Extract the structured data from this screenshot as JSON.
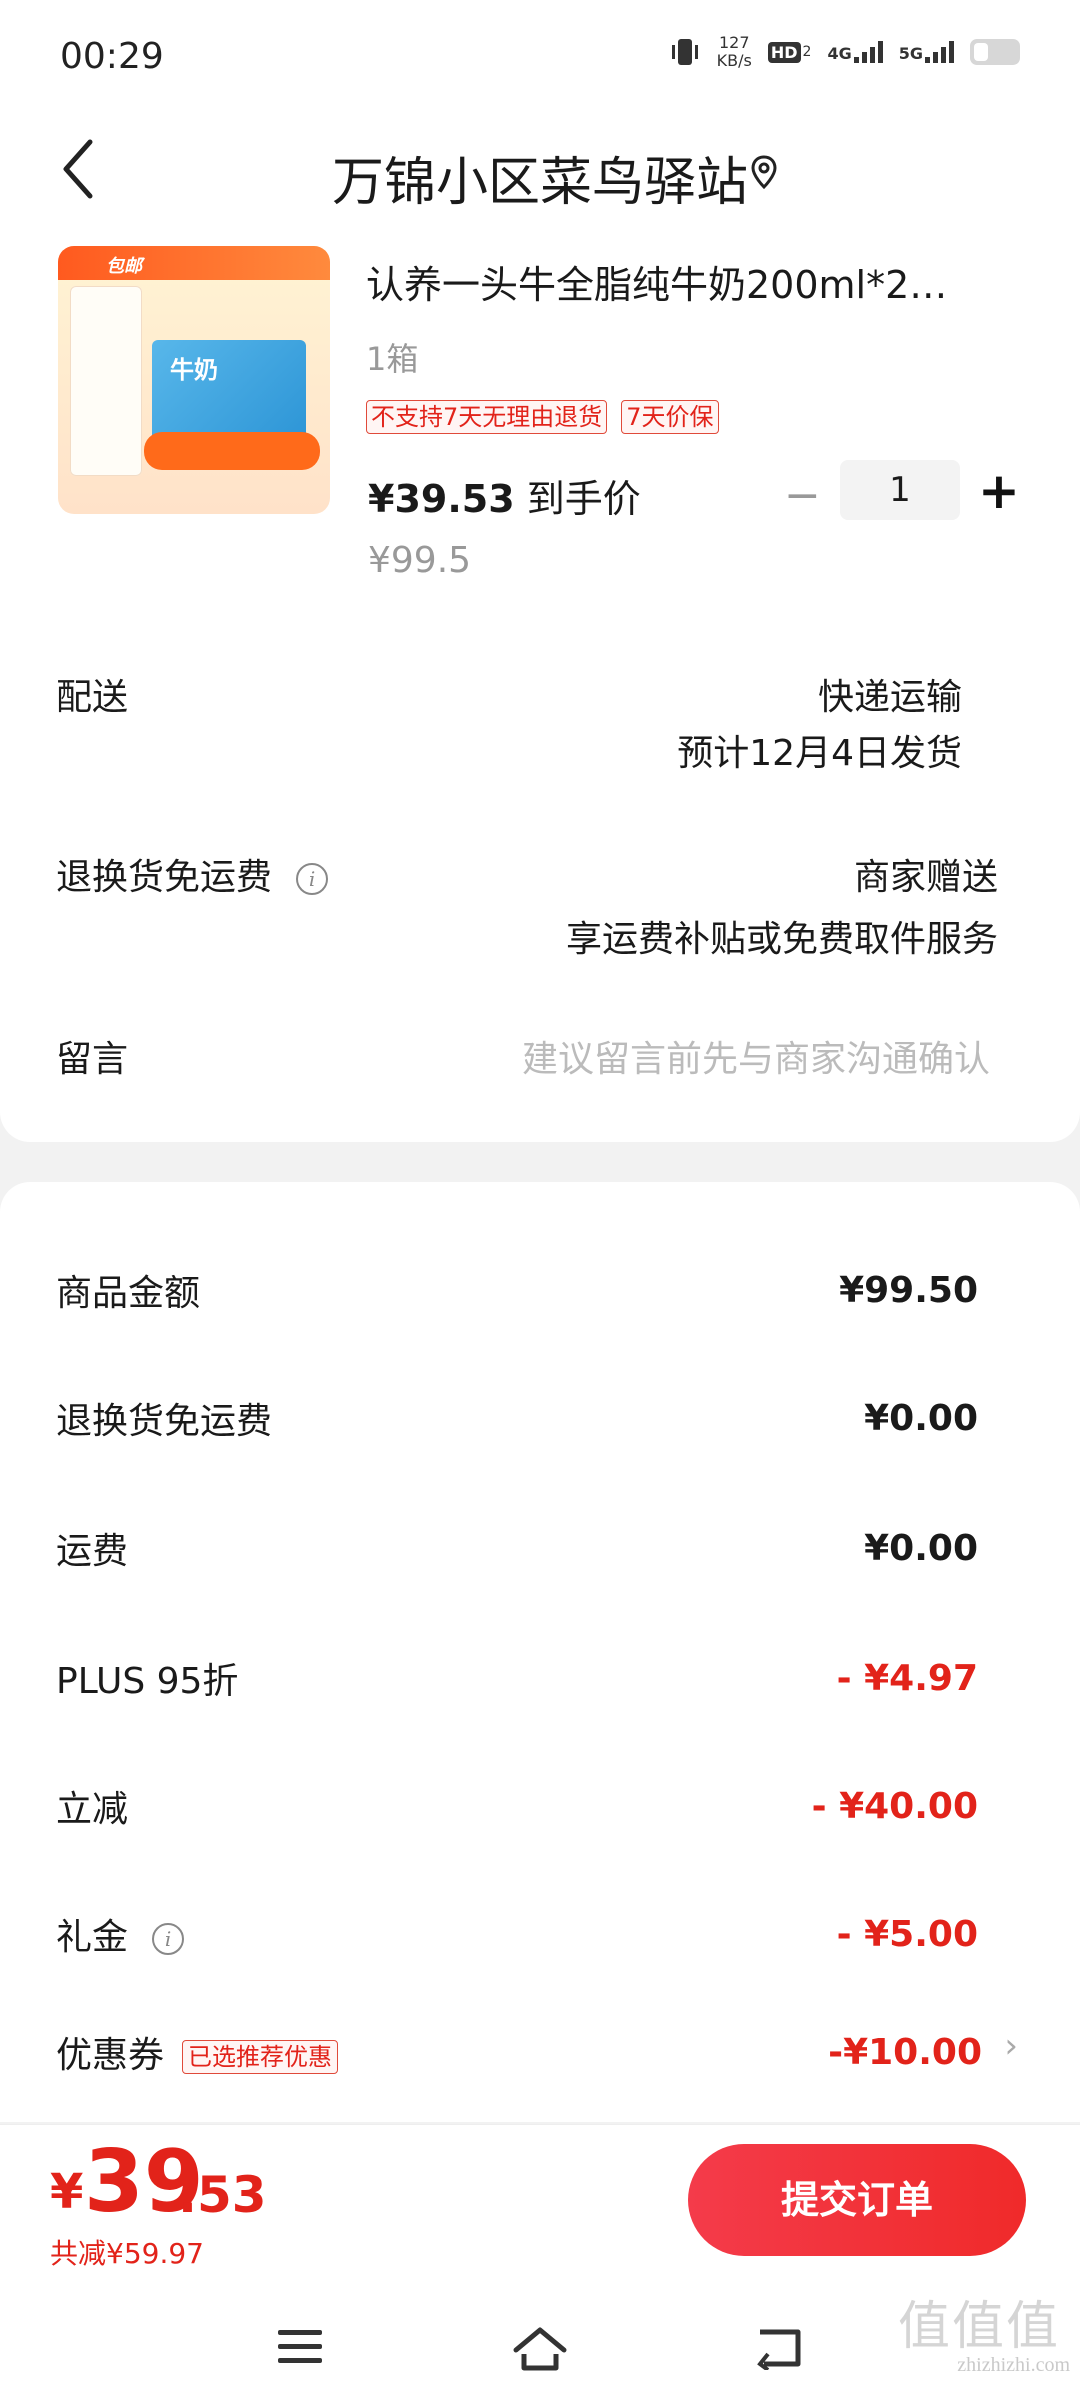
{
  "status_bar": {
    "time": "00:29",
    "speed": "127",
    "speed_unit": "KB/s",
    "hd": "HD",
    "hd_sub": "2",
    "net1": "4G",
    "net2": "5G"
  },
  "header": {
    "title": "万锦小区菜鸟驿站"
  },
  "product": {
    "image_label": "包邮",
    "image_text": "牛奶",
    "name": "认养一头牛全脂纯牛奶200ml*2…",
    "spec": "1箱",
    "tags": [
      "不支持7天无理由退货",
      "7天价保"
    ],
    "price": "¥39.53",
    "price_suffix": "到手价",
    "original_price": "¥99.5",
    "quantity": "1",
    "qty_minus": "−",
    "qty_plus": "+"
  },
  "delivery": {
    "label": "配送",
    "method": "快递运输",
    "eta": "预计12月4日发货"
  },
  "return_shipping": {
    "label": "退换货免运费",
    "value": "商家赠送",
    "desc": "享运费补贴或免费取件服务"
  },
  "message": {
    "label": "留言",
    "placeholder": "建议留言前先与商家沟通确认"
  },
  "fees": [
    {
      "label": "商品金额",
      "value": "¥99.50",
      "red": false
    },
    {
      "label": "退换货免运费",
      "value": "¥0.00",
      "red": false
    },
    {
      "label": "运费",
      "value": "¥0.00",
      "red": false
    },
    {
      "label": "PLUS 95折",
      "value": "- ¥4.97",
      "red": true
    },
    {
      "label": "立减",
      "value": "- ¥40.00",
      "red": true
    },
    {
      "label": "礼金",
      "value": "- ¥5.00",
      "red": true
    },
    {
      "label": "优惠券",
      "value": "-¥10.00",
      "red": true
    }
  ],
  "coupon_tag": "已选推荐优惠",
  "chevron": "›",
  "info_glyph": "i",
  "footer": {
    "currency": "¥",
    "total_int": "39",
    "total_dec": ".53",
    "saved": "共减¥59.97",
    "submit": "提交订单"
  },
  "watermark": {
    "big": "值值值",
    "small": "zhizhizhi.com"
  },
  "colors": {
    "accent": "#e2231a",
    "submit_bg": "#f23b3b"
  }
}
